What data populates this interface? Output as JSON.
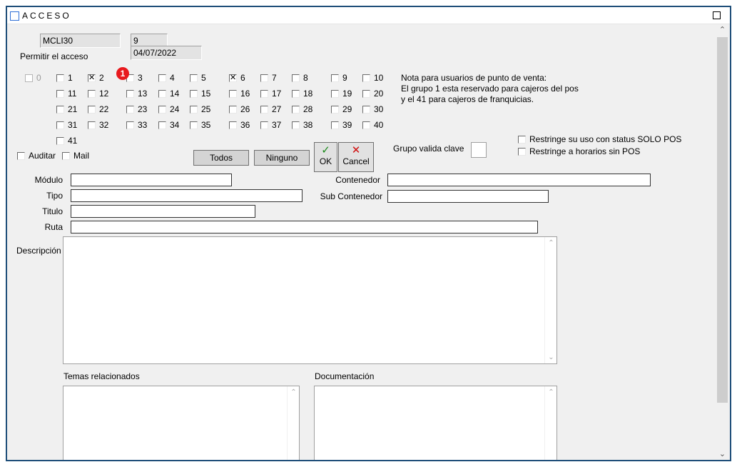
{
  "window": {
    "title": "ACCESO"
  },
  "header": {
    "code": "MCLI30",
    "number": "9",
    "date": "04/07/2022",
    "permit_label": "Permitir el acceso"
  },
  "groups": [
    {
      "label": "0",
      "checked": false,
      "disabled": true
    },
    {
      "label": "1",
      "checked": false
    },
    {
      "label": "2",
      "checked": true
    },
    {
      "label": "3",
      "checked": false
    },
    {
      "label": "4",
      "checked": false
    },
    {
      "label": "5",
      "checked": false
    },
    {
      "label": "6",
      "checked": true
    },
    {
      "label": "7",
      "checked": false
    },
    {
      "label": "8",
      "checked": false
    },
    {
      "label": "9",
      "checked": false
    },
    {
      "label": "10",
      "checked": false
    },
    {
      "label": "11",
      "checked": false
    },
    {
      "label": "12",
      "checked": false
    },
    {
      "label": "13",
      "checked": false
    },
    {
      "label": "14",
      "checked": false
    },
    {
      "label": "15",
      "checked": false
    },
    {
      "label": "16",
      "checked": false
    },
    {
      "label": "17",
      "checked": false
    },
    {
      "label": "18",
      "checked": false
    },
    {
      "label": "19",
      "checked": false
    },
    {
      "label": "20",
      "checked": false
    },
    {
      "label": "21",
      "checked": false
    },
    {
      "label": "22",
      "checked": false
    },
    {
      "label": "23",
      "checked": false
    },
    {
      "label": "24",
      "checked": false
    },
    {
      "label": "25",
      "checked": false
    },
    {
      "label": "26",
      "checked": false
    },
    {
      "label": "27",
      "checked": false
    },
    {
      "label": "28",
      "checked": false
    },
    {
      "label": "29",
      "checked": false
    },
    {
      "label": "30",
      "checked": false
    },
    {
      "label": "31",
      "checked": false
    },
    {
      "label": "32",
      "checked": false
    },
    {
      "label": "33",
      "checked": false
    },
    {
      "label": "34",
      "checked": false
    },
    {
      "label": "35",
      "checked": false
    },
    {
      "label": "36",
      "checked": false
    },
    {
      "label": "37",
      "checked": false
    },
    {
      "label": "38",
      "checked": false
    },
    {
      "label": "39",
      "checked": false
    },
    {
      "label": "40",
      "checked": false
    },
    {
      "label": "41",
      "checked": false
    }
  ],
  "badge": "1",
  "note": {
    "line1": "Nota para usuarios de punto de venta:",
    "line2": "El grupo 1 esta reservado para cajeros del pos",
    "line3": "y el 41 para cajeros de franquicias."
  },
  "options": {
    "auditar": "Auditar",
    "mail": "Mail",
    "restrict_pos": "Restringe su uso con status  SOLO POS",
    "restrict_hours": "Restringe a horarios sin POS"
  },
  "buttons": {
    "todos": "Todos",
    "ninguno": "Ninguno",
    "ok": "OK",
    "cancel": "Cancel"
  },
  "grupo_valida_clave": {
    "label": "Grupo valida clave",
    "value": ""
  },
  "form": {
    "modulo_label": "Módulo",
    "tipo_label": "Tipo",
    "titulo_label": "Titulo",
    "ruta_label": "Ruta",
    "contenedor_label": "Contenedor",
    "sub_contenedor_label": "Sub Contenedor",
    "descripcion_label": "Descripción",
    "temas_label": "Temas relacionados",
    "documentacion_label": "Documentación",
    "modulo": "",
    "tipo": "",
    "titulo": "",
    "ruta": "",
    "contenedor": "",
    "sub_contenedor": ""
  },
  "colors": {
    "window_border": "#1f4e79",
    "badge": "#e8191d",
    "ok_check": "#1a8a1a",
    "cancel_x": "#d01010"
  }
}
